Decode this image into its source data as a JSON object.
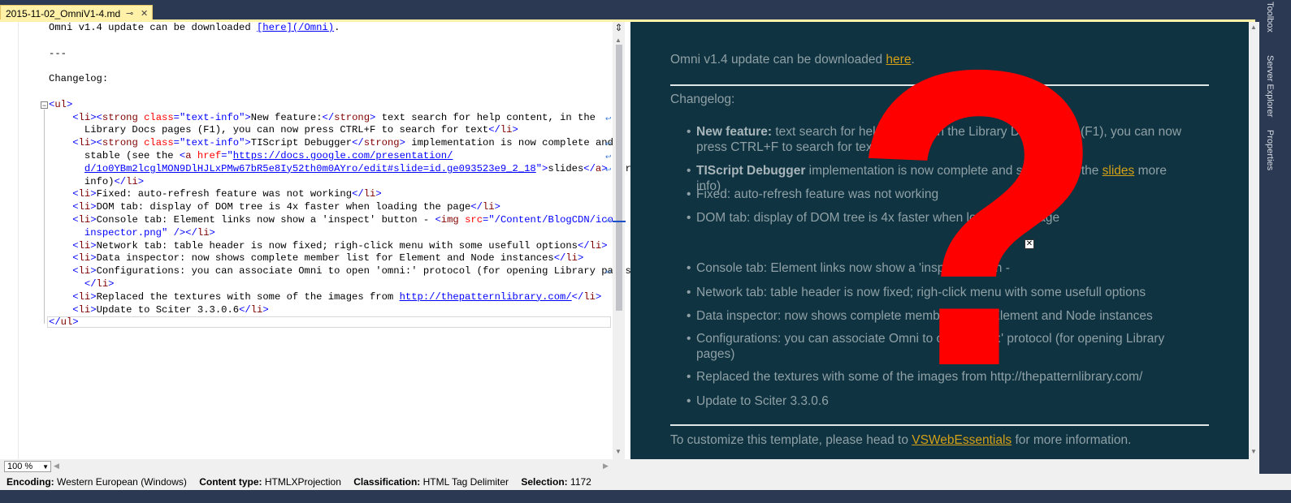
{
  "tab": {
    "title": "2015-11-02_OmniV1-4.md",
    "pin_glyph": "⊸",
    "close_glyph": "✕"
  },
  "editor": {
    "lines": [
      [
        {
          "c": "plain",
          "t": "Omni v1.4 update can be downloaded "
        },
        {
          "c": "link",
          "t": "[here](/Omni)"
        },
        {
          "c": "plain",
          "t": "."
        }
      ],
      [],
      [
        {
          "c": "plain",
          "t": "---"
        }
      ],
      [],
      [
        {
          "c": "plain",
          "t": "Changelog:"
        }
      ],
      [],
      [
        {
          "c": "tag",
          "t": "<"
        },
        {
          "c": "name",
          "t": "ul"
        },
        {
          "c": "tag",
          "t": ">"
        }
      ],
      [
        {
          "c": "plain",
          "t": "    "
        },
        {
          "c": "tag",
          "t": "<"
        },
        {
          "c": "name",
          "t": "li"
        },
        {
          "c": "tag",
          "t": "><"
        },
        {
          "c": "name",
          "t": "strong"
        },
        {
          "c": "plain",
          "t": " "
        },
        {
          "c": "attr",
          "t": "class"
        },
        {
          "c": "tag",
          "t": "=\"text-info\">"
        },
        {
          "c": "plain",
          "t": "New feature:"
        },
        {
          "c": "tag",
          "t": "</"
        },
        {
          "c": "name",
          "t": "strong"
        },
        {
          "c": "tag",
          "t": ">"
        },
        {
          "c": "plain",
          "t": " text search for help content, in the"
        }
      ],
      [
        {
          "c": "plain",
          "t": "      Library Docs pages (F1), you can now press CTRL+F to search for text"
        },
        {
          "c": "tag",
          "t": "</"
        },
        {
          "c": "name",
          "t": "li"
        },
        {
          "c": "tag",
          "t": ">"
        }
      ],
      [
        {
          "c": "plain",
          "t": "    "
        },
        {
          "c": "tag",
          "t": "<"
        },
        {
          "c": "name",
          "t": "li"
        },
        {
          "c": "tag",
          "t": "><"
        },
        {
          "c": "name",
          "t": "strong"
        },
        {
          "c": "plain",
          "t": " "
        },
        {
          "c": "attr",
          "t": "class"
        },
        {
          "c": "tag",
          "t": "=\"text-info\">"
        },
        {
          "c": "plain",
          "t": "TIScript Debugger"
        },
        {
          "c": "tag",
          "t": "</"
        },
        {
          "c": "name",
          "t": "strong"
        },
        {
          "c": "tag",
          "t": ">"
        },
        {
          "c": "plain",
          "t": " implementation is now complete and"
        }
      ],
      [
        {
          "c": "plain",
          "t": "      stable (see the "
        },
        {
          "c": "tag",
          "t": "<"
        },
        {
          "c": "name",
          "t": "a"
        },
        {
          "c": "plain",
          "t": " "
        },
        {
          "c": "attr",
          "t": "href"
        },
        {
          "c": "tag",
          "t": "=\""
        },
        {
          "c": "val",
          "t": "https://docs.google.com/presentation/"
        }
      ],
      [
        {
          "c": "plain",
          "t": "      "
        },
        {
          "c": "val",
          "t": "d/1o0YBm2lcglMON9DlHJLxPMw67bR5e8Iy52th0m0AYro/edit#slide=id.ge093523e9_2_18"
        },
        {
          "c": "tag",
          "t": "\">"
        },
        {
          "c": "plain",
          "t": "slides"
        },
        {
          "c": "tag",
          "t": "</"
        },
        {
          "c": "name",
          "t": "a"
        },
        {
          "c": "tag",
          "t": ">"
        },
        {
          "c": "plain",
          "t": " more"
        }
      ],
      [
        {
          "c": "plain",
          "t": "      info)"
        },
        {
          "c": "tag",
          "t": "</"
        },
        {
          "c": "name",
          "t": "li"
        },
        {
          "c": "tag",
          "t": ">"
        }
      ],
      [
        {
          "c": "plain",
          "t": "    "
        },
        {
          "c": "tag",
          "t": "<"
        },
        {
          "c": "name",
          "t": "li"
        },
        {
          "c": "tag",
          "t": ">"
        },
        {
          "c": "plain",
          "t": "Fixed: auto-refresh feature was not working"
        },
        {
          "c": "tag",
          "t": "</"
        },
        {
          "c": "name",
          "t": "li"
        },
        {
          "c": "tag",
          "t": ">"
        }
      ],
      [
        {
          "c": "plain",
          "t": "    "
        },
        {
          "c": "tag",
          "t": "<"
        },
        {
          "c": "name",
          "t": "li"
        },
        {
          "c": "tag",
          "t": ">"
        },
        {
          "c": "plain",
          "t": "DOM tab: display of DOM tree is 4x faster when loading the page"
        },
        {
          "c": "tag",
          "t": "</"
        },
        {
          "c": "name",
          "t": "li"
        },
        {
          "c": "tag",
          "t": ">"
        }
      ],
      [
        {
          "c": "plain",
          "t": "    "
        },
        {
          "c": "tag",
          "t": "<"
        },
        {
          "c": "name",
          "t": "li"
        },
        {
          "c": "tag",
          "t": ">"
        },
        {
          "c": "plain",
          "t": "Console tab: Element links now show a 'inspect' button - "
        },
        {
          "c": "tag",
          "t": "<"
        },
        {
          "c": "name",
          "t": "img"
        },
        {
          "c": "plain",
          "t": " "
        },
        {
          "c": "attr",
          "t": "src"
        },
        {
          "c": "tag",
          "t": "=\"/Content/BlogCDN/icon-"
        }
      ],
      [
        {
          "c": "plain",
          "t": "      "
        },
        {
          "c": "tag",
          "t": "inspector.png\" />"
        },
        {
          "c": "tag",
          "t": "</"
        },
        {
          "c": "name",
          "t": "li"
        },
        {
          "c": "tag",
          "t": ">"
        }
      ],
      [
        {
          "c": "plain",
          "t": "    "
        },
        {
          "c": "tag",
          "t": "<"
        },
        {
          "c": "name",
          "t": "li"
        },
        {
          "c": "tag",
          "t": ">"
        },
        {
          "c": "plain",
          "t": "Network tab: table header is now fixed; righ-click menu with some usefull options"
        },
        {
          "c": "tag",
          "t": "</"
        },
        {
          "c": "name",
          "t": "li"
        },
        {
          "c": "tag",
          "t": ">"
        }
      ],
      [
        {
          "c": "plain",
          "t": "    "
        },
        {
          "c": "tag",
          "t": "<"
        },
        {
          "c": "name",
          "t": "li"
        },
        {
          "c": "tag",
          "t": ">"
        },
        {
          "c": "plain",
          "t": "Data inspector: now shows complete member list for Element and Node instances"
        },
        {
          "c": "tag",
          "t": "</"
        },
        {
          "c": "name",
          "t": "li"
        },
        {
          "c": "tag",
          "t": ">"
        }
      ],
      [
        {
          "c": "plain",
          "t": "    "
        },
        {
          "c": "tag",
          "t": "<"
        },
        {
          "c": "name",
          "t": "li"
        },
        {
          "c": "tag",
          "t": ">"
        },
        {
          "c": "plain",
          "t": "Configurations: you can associate Omni to open 'omni:' protocol (for opening Library pages)"
        }
      ],
      [
        {
          "c": "plain",
          "t": "      "
        },
        {
          "c": "tag",
          "t": "</"
        },
        {
          "c": "name",
          "t": "li"
        },
        {
          "c": "tag",
          "t": ">"
        }
      ],
      [
        {
          "c": "plain",
          "t": "    "
        },
        {
          "c": "tag",
          "t": "<"
        },
        {
          "c": "name",
          "t": "li"
        },
        {
          "c": "tag",
          "t": ">"
        },
        {
          "c": "plain",
          "t": "Replaced the textures with some of the images from "
        },
        {
          "c": "link",
          "t": "http://thepatternlibrary.com/"
        },
        {
          "c": "tag",
          "t": "</"
        },
        {
          "c": "name",
          "t": "li"
        },
        {
          "c": "tag",
          "t": ">"
        }
      ],
      [
        {
          "c": "plain",
          "t": "    "
        },
        {
          "c": "tag",
          "t": "<"
        },
        {
          "c": "name",
          "t": "li"
        },
        {
          "c": "tag",
          "t": ">"
        },
        {
          "c": "plain",
          "t": "Update to Sciter 3.3.0.6"
        },
        {
          "c": "tag",
          "t": "</"
        },
        {
          "c": "name",
          "t": "li"
        },
        {
          "c": "tag",
          "t": ">"
        }
      ],
      [
        {
          "c": "tag",
          "t": "</"
        },
        {
          "c": "name",
          "t": "ul"
        },
        {
          "c": "tag",
          "t": ">"
        }
      ]
    ],
    "wrap_glyph": "↩",
    "collapse_glyph": "−"
  },
  "preview": {
    "intro_text": "Omni v1.4 update can be downloaded ",
    "intro_link": "here",
    "intro_tail": ".",
    "changelog": "Changelog:",
    "items": [
      {
        "strong": "New feature:",
        "text": " text search for help content, in the Library Docs pages (F1), you can now"
      },
      {
        "strong": "TIScript Debugger",
        "text": " implementation is now complete and stable (see the "
      },
      {
        "strong": "",
        "text": "Fixed: auto-refresh feature was not working"
      },
      {
        "strong": "",
        "text": "DOM tab: display of DOM tree is 4x faster when loading the page"
      },
      {
        "strong": "",
        "text": "Console tab: Element links now show a 'inspect' button -"
      },
      {
        "strong": "",
        "text": "Network tab: table header is now fixed; righ-click menu with some usefull options"
      },
      {
        "strong": "",
        "text": "Data inspector: now shows complete member list for Element and Node instances"
      },
      {
        "strong": "",
        "text": "Configurations: you can associate Omni to open 'omni:' protocol (for opening Library"
      },
      {
        "strong": "",
        "text": "Replaced the textures with some of the images from http://thepatternlibrary.com/"
      },
      {
        "strong": "",
        "text": "Update to Sciter 3.3.0.6"
      }
    ],
    "item1_line2": "press CTRL+F to search for text",
    "item2_link": "slides",
    "item2_tail": " more info)",
    "item8_line2": "pages)",
    "footer_text": "To customize this template, please head to ",
    "footer_link": "VSWebEssentials",
    "footer_tail": " for more information.",
    "overlay_glyph": "?",
    "broken_image_glyph": "✕"
  },
  "right_rail": [
    "Toolbox",
    "Server Explorer",
    "Properties"
  ],
  "zoom": {
    "value": "100 %"
  },
  "status": {
    "encoding_label": "Encoding:",
    "encoding_value": "Western European (Windows)",
    "content_type_label": "Content type:",
    "content_type_value": "HTMLXProjection",
    "classification_label": "Classification:",
    "classification_value": "HTML Tag Delimiter",
    "selection_label": "Selection:",
    "selection_value": "1172"
  },
  "colors": {
    "accent_tab": "#fff1a8",
    "preview_bg": "#0f3340",
    "link_gold": "#d4a017",
    "overlay_red": "#ff0000"
  }
}
